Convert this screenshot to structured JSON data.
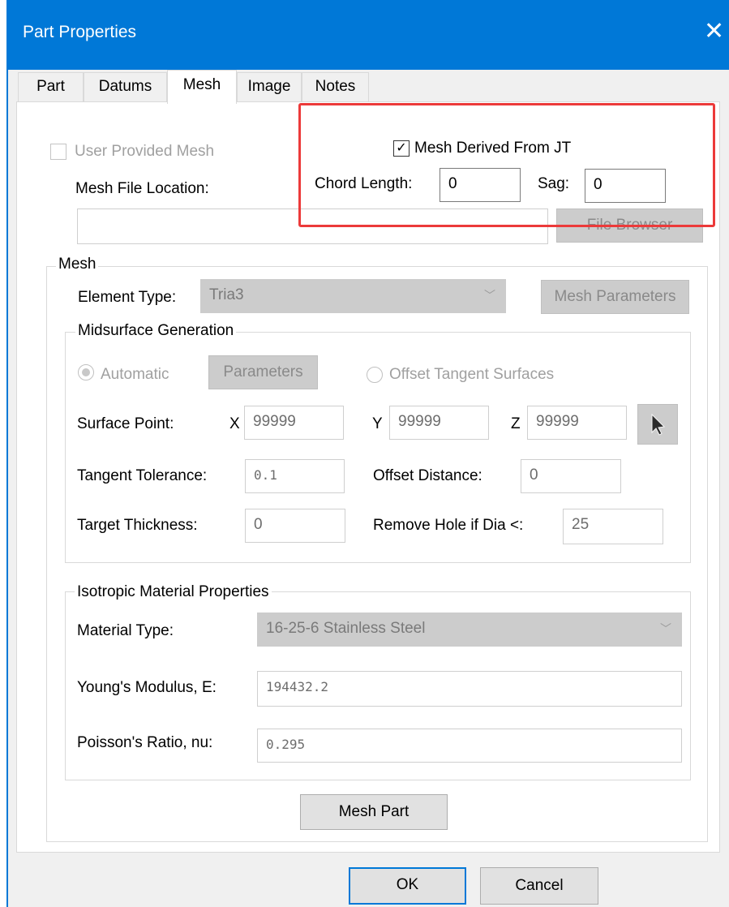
{
  "window": {
    "title": "Part Properties",
    "close_glyph": "✕"
  },
  "tabs": [
    {
      "label": "Part",
      "active": false
    },
    {
      "label": "Datums",
      "active": false
    },
    {
      "label": "Mesh",
      "active": true
    },
    {
      "label": "Image",
      "active": false
    },
    {
      "label": "Notes",
      "active": false
    }
  ],
  "mesh_file": {
    "user_provided_label": "User Provided Mesh",
    "location_label": "Mesh File Location:",
    "location_value": "",
    "browse_label": "File Browser"
  },
  "jt": {
    "derived_label": "Mesh Derived From JT",
    "derived_checked": true,
    "chord_label": "Chord Length:",
    "chord_value": "0",
    "sag_label": "Sag:",
    "sag_value": "0"
  },
  "mesh_group": {
    "legend": "Mesh",
    "element_type_label": "Element Type:",
    "element_type_value": "Tria3",
    "mesh_parameters_label": "Mesh Parameters"
  },
  "midsurface": {
    "legend": "Midsurface Generation",
    "automatic_label": "Automatic",
    "parameters_label": "Parameters",
    "offset_tangent_label": "Offset Tangent Surfaces",
    "surface_point_label": "Surface Point:",
    "x_label": "X",
    "x_value": "99999",
    "y_label": "Y",
    "y_value": "99999",
    "z_label": "Z",
    "z_value": "99999",
    "tangent_tol_label": "Tangent Tolerance:",
    "tangent_tol_value": "0.1",
    "offset_dist_label": "Offset Distance:",
    "offset_dist_value": "0",
    "target_thick_label": "Target Thickness:",
    "target_thick_value": "0",
    "remove_hole_label": "Remove Hole if Dia <:",
    "remove_hole_value": "25"
  },
  "material": {
    "legend": "Isotropic Material Properties",
    "type_label": "Material Type:",
    "type_value": "16-25-6 Stainless Steel",
    "youngs_label": "Young's Modulus, E:",
    "youngs_value": "194432.2",
    "poisson_label": "Poisson's Ratio, nu:",
    "poisson_value": "0.295"
  },
  "actions": {
    "mesh_part_label": "Mesh Part",
    "ok_label": "OK",
    "cancel_label": "Cancel"
  },
  "colors": {
    "titlebar": "#0078d7",
    "highlight": "#ec3a3a"
  }
}
